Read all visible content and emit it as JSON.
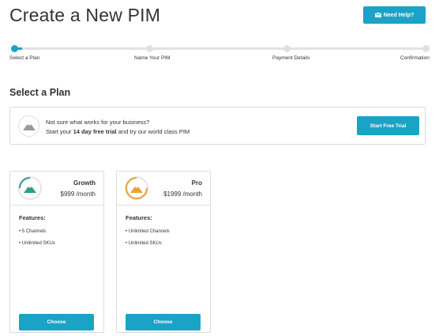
{
  "page": {
    "title": "Create a New PIM"
  },
  "header": {
    "help_label": "Need Help?",
    "help_icon": "mail-icon"
  },
  "stepper": {
    "current_step": 1,
    "steps": [
      {
        "label": "Select a Plan"
      },
      {
        "label": "Name Your PIM"
      },
      {
        "label": "Payment Details"
      },
      {
        "label": "Confirmation"
      }
    ]
  },
  "section": {
    "title": "Select a Plan"
  },
  "trial": {
    "line1": "Not sure what works for your business?",
    "line2_prefix": "Start your ",
    "line2_bold": "14 day free trial",
    "line2_suffix": " and try our world class PIM",
    "button_label": "Start Free Trial",
    "icon": "mountain-icon"
  },
  "plans": [
    {
      "name": "Growth",
      "price": "$999 /month",
      "accent": "#2e9e8c",
      "features_title": "Features:",
      "features": [
        "5 Channels",
        "Unlimited SKUs"
      ],
      "button_label": "Choose",
      "icon": "mountain-icon"
    },
    {
      "name": "Pro",
      "price": "$1999 /month",
      "accent": "#e9a23b",
      "features_title": "Features:",
      "features": [
        "Unlimited Channels",
        "Unlimited SKUs"
      ],
      "button_label": "Choose",
      "icon": "mountain-icon"
    }
  ],
  "colors": {
    "primary": "#1ba3c6",
    "border": "#dcdcdc",
    "text": "#333333"
  }
}
